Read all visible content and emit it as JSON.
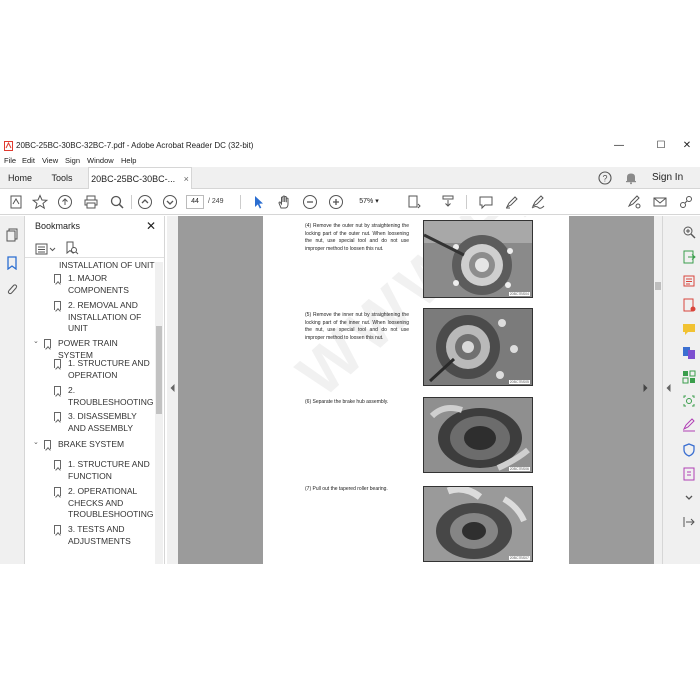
{
  "window": {
    "title": "20BC-25BC-30BC-32BC-7.pdf - Adobe Acrobat Reader DC (32-bit)",
    "controls": {
      "minimize": "—",
      "maximize": "☐",
      "close": "✕"
    }
  },
  "menu": [
    "File",
    "Edit",
    "View",
    "Sign",
    "Window",
    "Help"
  ],
  "tabs": {
    "home": "Home",
    "tools": "Tools",
    "document": "20BC-25BC-30BC-...",
    "document_close": "×",
    "sign_in": "Sign In"
  },
  "toolbar": {
    "current_page": "44",
    "page_total": "/ 249",
    "zoom": "57%",
    "zoom_caret": "▾"
  },
  "bookmarks": {
    "header": "Bookmarks",
    "close": "✕",
    "items": [
      {
        "label": "INSTALLATION OF UNIT",
        "level": 2,
        "caret": ""
      },
      {
        "label": "1. MAJOR COMPONENTS",
        "level": 2,
        "caret": ""
      },
      {
        "label": "2. REMOVAL AND INSTALLATION OF UNIT",
        "level": 2,
        "caret": ""
      },
      {
        "label": "POWER TRAIN SYSTEM",
        "level": 1,
        "caret": "⌄"
      },
      {
        "label": "1. STRUCTURE AND OPERATION",
        "level": 2,
        "caret": ""
      },
      {
        "label": "2. TROUBLESHOOTING",
        "level": 2,
        "caret": ""
      },
      {
        "label": "3. DISASSEMBLY AND ASSEMBLY",
        "level": 2,
        "caret": ""
      },
      {
        "label": "BRAKE SYSTEM",
        "level": 1,
        "caret": "⌄"
      },
      {
        "label": "1. STRUCTURE AND FUNCTION",
        "level": 2,
        "caret": ""
      },
      {
        "label": "2. OPERATIONAL CHECKS AND TROUBLESHOOTING",
        "level": 2,
        "caret": ""
      },
      {
        "label": "3. TESTS AND ADJUSTMENTS",
        "level": 2,
        "caret": ""
      }
    ]
  },
  "document": {
    "watermark": "WWW.EPCDEPOT.COM",
    "steps": [
      {
        "text": "(4) Remove the outer nut by straightening the locking part of the outer nut. When loosening the nut, use special tool and do not use improper method to loosen this nut.",
        "photo_tag": "20BC7BS04"
      },
      {
        "text": "(5) Remove the inner nut by straightening the locking part of the inner nut. When loosening the nut, use special tool and do not use improper method to loosen this nut.",
        "photo_tag": "20BC7BS05"
      },
      {
        "text": "(6) Separate the brake hub assembly.",
        "photo_tag": "20BC7BS06"
      },
      {
        "text": "(7) Pull out the tapered roller bearing.",
        "photo_tag": "20BC7BS07"
      }
    ]
  },
  "colors": {
    "accent": "#2b6ed1",
    "acrobat_red": "#e03a2f",
    "viewer_bg": "#9b9b9b",
    "chrome_bg": "#f0f0f0"
  }
}
